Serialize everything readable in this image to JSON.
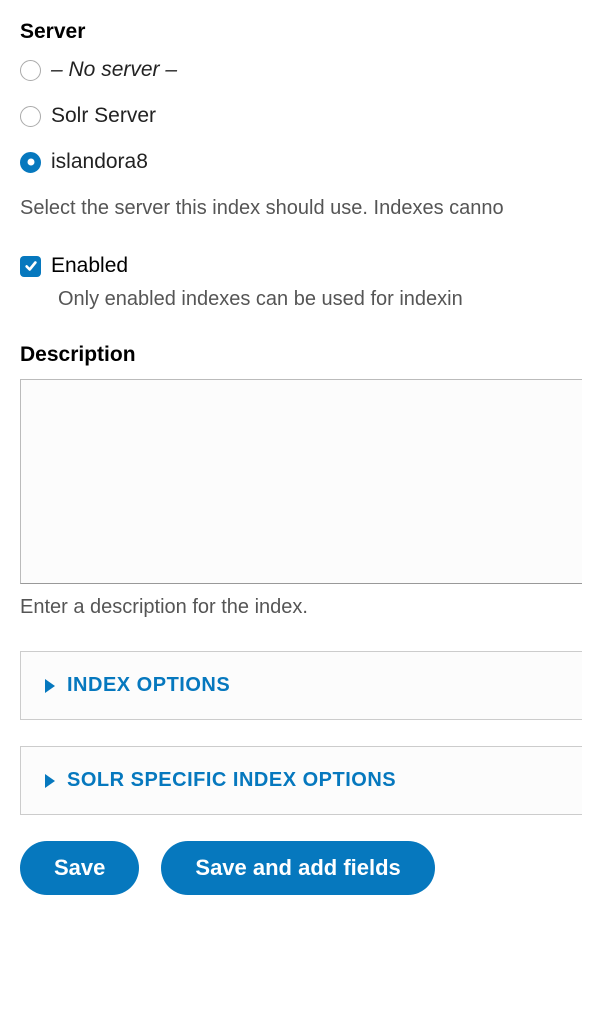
{
  "server": {
    "label": "Server",
    "options": [
      {
        "label": "– No server –",
        "italic": true,
        "selected": false
      },
      {
        "label": "Solr Server",
        "italic": false,
        "selected": false
      },
      {
        "label": "islandora8",
        "italic": false,
        "selected": true
      }
    ],
    "help": "Select the server this index should use. Indexes canno"
  },
  "enabled": {
    "label": "Enabled",
    "checked": true,
    "help": "Only enabled indexes can be used for indexin"
  },
  "description": {
    "label": "Description",
    "value": "",
    "help": "Enter a description for the index."
  },
  "collapsibles": [
    {
      "title": "INDEX OPTIONS"
    },
    {
      "title": "SOLR SPECIFIC INDEX OPTIONS"
    }
  ],
  "buttons": {
    "save": "Save",
    "save_add": "Save and add fields"
  }
}
